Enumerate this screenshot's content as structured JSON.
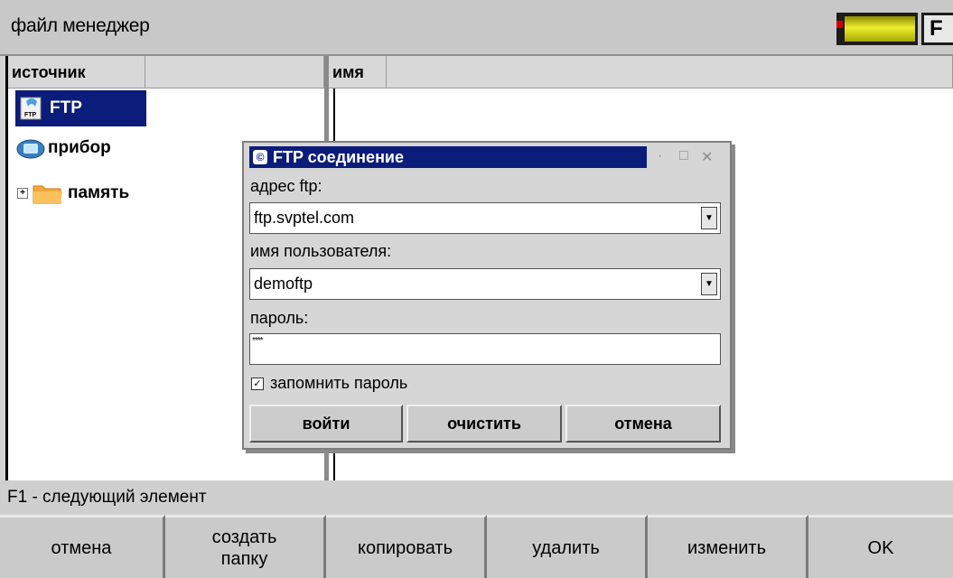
{
  "window": {
    "title": "файл менеджер",
    "fkey_label": "F",
    "battery_color": "#e0e020"
  },
  "left_pane": {
    "headers": [
      "источник",
      ""
    ],
    "items": [
      {
        "label": "FTP",
        "icon": "ftp-icon",
        "selected": true
      },
      {
        "label": "прибор",
        "icon": "device-icon",
        "selected": false
      },
      {
        "label": "память",
        "icon": "folder-icon",
        "selected": false,
        "expander": "+"
      }
    ]
  },
  "right_pane": {
    "headers": [
      "имя",
      ""
    ]
  },
  "dialog": {
    "title": "FTP соединение",
    "ftp_address_label": "адрес ftp:",
    "ftp_address_value": "ftp.svptel.com",
    "username_label": "имя пользователя:",
    "username_value": "demoftp",
    "password_label": "пароль:",
    "password_value": "****",
    "remember_label": "запомнить пароль",
    "remember_checked": true,
    "buttons": {
      "login": "войти",
      "clear": "очистить",
      "cancel": "отмена"
    },
    "window_controls": {
      "minimize": "·",
      "maximize": "□",
      "close": "✕"
    }
  },
  "status": {
    "text": "F1 - следующий элемент"
  },
  "footer": {
    "buttons": [
      "отмена",
      "создать папку",
      "копировать",
      "удалить",
      "изменить",
      "OK"
    ]
  },
  "colors": {
    "selection": "#0b1c7a",
    "dialog_bg": "#d6d6d6"
  }
}
